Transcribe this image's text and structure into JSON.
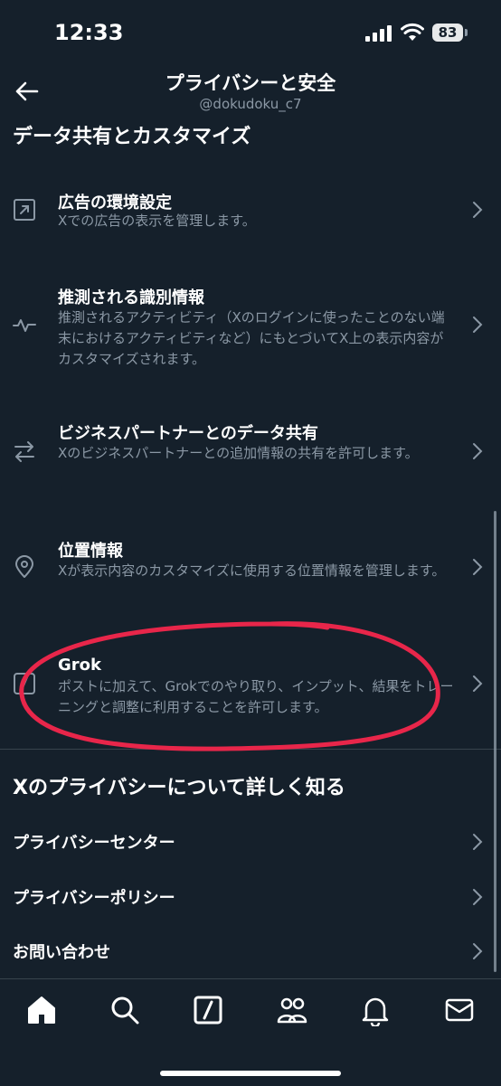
{
  "status_bar": {
    "time": "12:33",
    "battery": "83"
  },
  "header": {
    "title": "プライバシーと安全",
    "handle": "@dokudoku_c7"
  },
  "section_data": {
    "title": "データ共有とカスタマイズ",
    "items": [
      {
        "icon": "external-arrow-icon",
        "title": "広告の環境設定",
        "desc": "Xでの広告の表示を管理します。"
      },
      {
        "icon": "activity-icon",
        "title": "推測される識別情報",
        "desc": "推測されるアクティビティ（Xのログインに使ったことのない端末におけるアクティビティなど）にもとづいてX上の表示内容がカスタマイズされます。"
      },
      {
        "icon": "swap-arrows-icon",
        "title": "ビジネスパートナーとのデータ共有",
        "desc": "Xのビジネスパートナーとの追加情報の共有を許可します。"
      },
      {
        "icon": "location-pin-icon",
        "title": "位置情報",
        "desc": "Xが表示内容のカスタマイズに使用する位置情報を管理します。"
      },
      {
        "icon": "grok-icon",
        "title": "Grok",
        "desc": "ポストに加えて、Grokでのやり取り、インプット、結果をトレーニングと調整に利用することを許可します。"
      }
    ]
  },
  "section_learn": {
    "title": "Xのプライバシーについて詳しく知る",
    "links": [
      {
        "label": "プライバシーセンター"
      },
      {
        "label": "プライバシーポリシー"
      },
      {
        "label": "お問い合わせ"
      }
    ]
  },
  "tab_bar": {
    "tabs": [
      "home-icon",
      "search-icon",
      "grok-icon",
      "communities-icon",
      "bell-icon",
      "mail-icon"
    ]
  },
  "colors": {
    "background": "#15202b",
    "text": "#e7e9ea",
    "secondary": "#8b98a5",
    "annotation": "#e8264a"
  }
}
